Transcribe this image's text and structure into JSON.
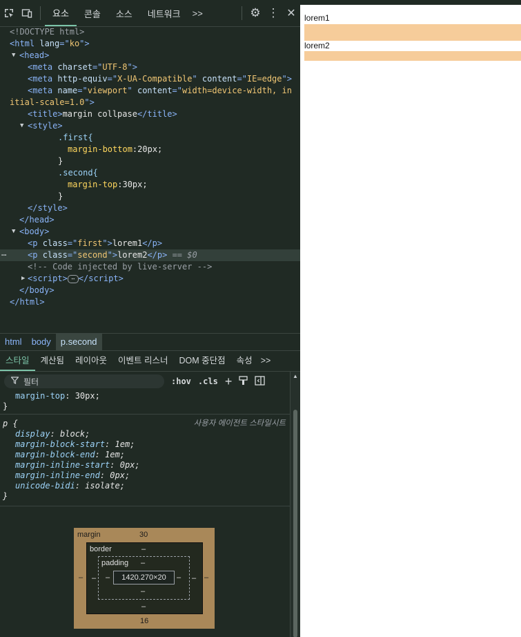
{
  "toolbar": {
    "tabs": [
      "요소",
      "콘솔",
      "소스",
      "네트워크"
    ],
    "active_tab": "요소",
    "more": ">>",
    "settings_icon": "⚙",
    "menu_icon": "⋮",
    "close_icon": "✕"
  },
  "code": {
    "doctype": "<!DOCTYPE html>",
    "html_lang": "ko",
    "meta_charset": "UTF-8",
    "meta_http_equiv": "X-UA-Compatible",
    "meta_http_content": "IE=edge",
    "meta_viewport_name": "viewport",
    "meta_viewport_content_1": "width=device-width, in",
    "meta_viewport_content_2": "itial-scale=1.0",
    "title": "margin collpase",
    "css_first_sel": ".first{",
    "css_first_prop": "margin-bottom",
    "css_first_val": ":20px;",
    "css_second_sel": ".second{",
    "css_second_prop": "margin-top",
    "css_second_val": ":30px;",
    "p1_class": "first",
    "p1_text": "lorem1",
    "p2_class": "second",
    "p2_text": "lorem2",
    "selected_marker": "== $0",
    "comment": "<!-- Code injected by live-server -->"
  },
  "breadcrumb": [
    "html",
    "body",
    "p.second"
  ],
  "subtabs": [
    "스타일",
    "계산됨",
    "레이아웃",
    "이벤트 리스너",
    "DOM 중단점",
    "속성"
  ],
  "subtabs_more": ">>",
  "filter": {
    "placeholder": "필터",
    "hov": ":hov",
    "cls": ".cls"
  },
  "styles": {
    "prev_prop": "margin-top",
    "prev_val": "30px",
    "ua_selector": "p {",
    "ua_label": "사용자 에이전트 스타일시트",
    "ua_props": [
      {
        "name": "display",
        "value": "block"
      },
      {
        "name": "margin-block-start",
        "value": "1em"
      },
      {
        "name": "margin-block-end",
        "value": "1em"
      },
      {
        "name": "margin-inline-start",
        "value": "0px"
      },
      {
        "name": "margin-inline-end",
        "value": "0px"
      },
      {
        "name": "unicode-bidi",
        "value": "isolate"
      }
    ]
  },
  "box_model": {
    "margin_label": "margin",
    "margin_top": "30",
    "margin_bottom": "16",
    "margin_left": "–",
    "margin_right": "–",
    "border_label": "border",
    "border_top": "–",
    "border_bottom": "–",
    "border_left": "–",
    "border_right": "–",
    "padding_label": "padding",
    "padding_top": "–",
    "padding_bottom": "–",
    "padding_left": "–",
    "padding_right": "–",
    "content": "1420.270×20"
  },
  "preview": {
    "p1": "lorem1",
    "p2": "lorem2",
    "margin_color": "#f6cc9a"
  }
}
